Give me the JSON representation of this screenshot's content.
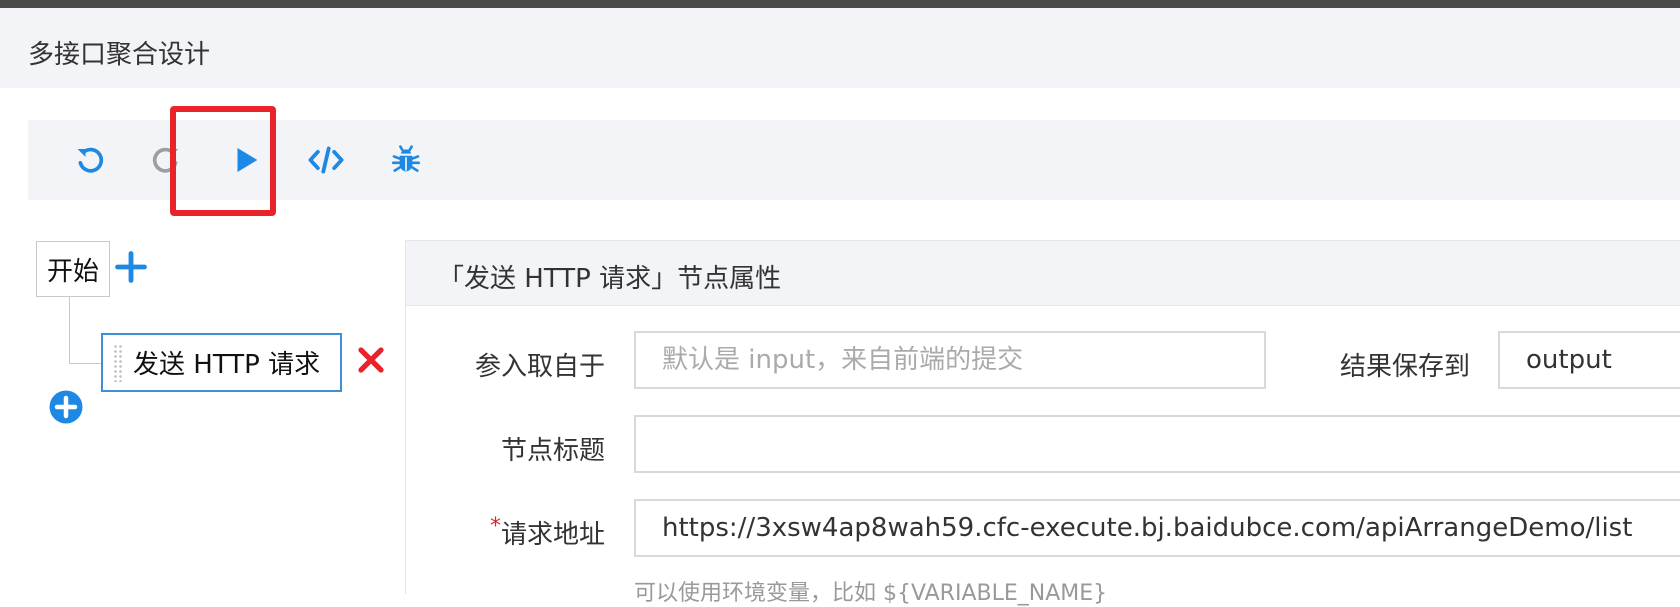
{
  "header": {
    "title": "多接口聚合设计"
  },
  "toolbar": {
    "buttons": [
      {
        "name": "undo",
        "icon": "undo-icon",
        "color": "#1e88e5"
      },
      {
        "name": "redo",
        "icon": "redo-icon",
        "color": "#9e9e9e"
      },
      {
        "name": "run",
        "icon": "play-icon",
        "color": "#1e88e5",
        "highlighted": true
      },
      {
        "name": "code",
        "icon": "code-icon",
        "color": "#1e88e5"
      },
      {
        "name": "debug",
        "icon": "bug-icon",
        "color": "#1e88e5"
      }
    ],
    "highlight_color": "#e8232a"
  },
  "tree": {
    "start_label": "开始",
    "node_label": "发送 HTTP 请求"
  },
  "panel": {
    "title": "「发送 HTTP 请求」节点属性",
    "input_from_label": "参入取自于",
    "input_from_placeholder": "默认是 input，来自前端的提交",
    "save_to_label": "结果保存到",
    "save_to_value": "output",
    "node_title_label": "节点标题",
    "node_title_value": "",
    "url_required_mark": "*",
    "url_label": "请求地址",
    "url_value": "https://3xsw4ap8wah59.cfc-execute.bj.baidubce.com/apiArrangeDemo/list",
    "url_hint": "可以使用环境变量，比如 ${VARIABLE_NAME}"
  }
}
